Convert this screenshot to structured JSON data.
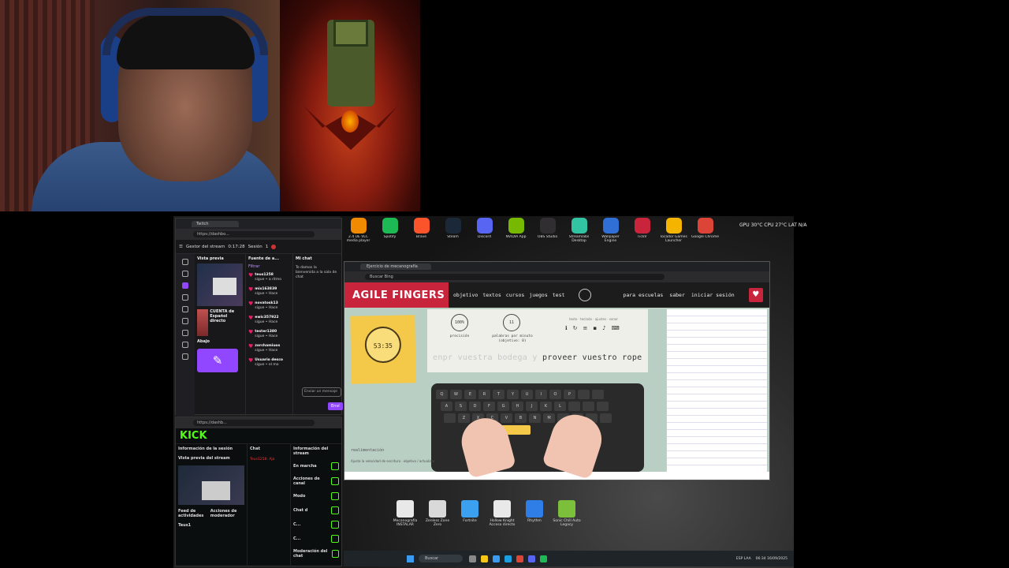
{
  "desktop_icons": [
    {
      "label": "2.4 UE VLC media player",
      "color": "#f08a00",
      "icon": "vlc-icon"
    },
    {
      "label": "Spotify",
      "color": "#1db954",
      "icon": "spotify-icon"
    },
    {
      "label": "Brave",
      "color": "#fb542b",
      "icon": "brave-icon"
    },
    {
      "label": "Steam",
      "color": "#1b2838",
      "icon": "steam-icon"
    },
    {
      "label": "Discord",
      "color": "#5865f2",
      "icon": "discord-icon"
    },
    {
      "label": "NVIDIA App",
      "color": "#76b900",
      "icon": "nvidia-icon"
    },
    {
      "label": "OBS Studio",
      "color": "#302e31",
      "icon": "obs-icon"
    },
    {
      "label": "Streamlabs Desktop",
      "color": "#31c3a2",
      "icon": "streamlabs-icon"
    },
    {
      "label": "Wallpaper Engine",
      "color": "#2f6fd6",
      "icon": "wallpaper-engine-icon"
    },
    {
      "label": "TickV",
      "color": "#c8243c",
      "icon": "tickv-icon"
    },
    {
      "label": "Tocador Games Launcher",
      "color": "#f4b400",
      "icon": "launcher-icon"
    },
    {
      "label": "Google Chrome",
      "color": "#db4437",
      "icon": "chrome-icon"
    }
  ],
  "system_stats": "GPU 30°C  CPU 27°C  LAT N/A",
  "twitch": {
    "tab_title": "Twitch",
    "url": "https://dashbo...",
    "manager_label": "Gestor del stream",
    "timer": "0:17:28",
    "timer_sub": "Sesión",
    "viewers": "1",
    "preview_header": "Vista previa",
    "activity_header": "Fuente de a...",
    "chat_header": "Mi chat",
    "filter": "Filtrar",
    "followers": [
      {
        "name": "teus1258",
        "action": "sigue • a ritmo"
      },
      {
        "name": "mix163839",
        "action": "sigue • Hace"
      },
      {
        "name": "novatosk13",
        "action": "sigue • Hace"
      },
      {
        "name": "ewic357922",
        "action": "sigue • Hace"
      },
      {
        "name": "tester1380",
        "action": "sigue • Hace"
      },
      {
        "name": "zorchamiuos",
        "action": "sigue • Hace"
      },
      {
        "name": "Usuario desco",
        "action": "sigue • el mo"
      }
    ],
    "welcome": "Te damos la bienvenida a la sala de chat",
    "card_title": "CUENTA de Español directo",
    "below_label": "Abajo",
    "chat_placeholder": "Enviar un mensaje",
    "send_label": "Enví"
  },
  "kick": {
    "logo": "KICK",
    "url": "https://dashb...",
    "info_label": "Información de la sesión",
    "preview_label": "Vista previa del stream",
    "feed_label": "Feed de actividades",
    "mod_actions_label": "Acciones de moderador",
    "feed_user": "Teus1",
    "chat_label": "Chat",
    "chat_msg": "Teus1258: Aja",
    "stream_info_label": "Información del stream",
    "rows": [
      "En marcha",
      "Acciones de canal",
      "Modo",
      "Chat d",
      "C...",
      "C...",
      "Moderación del chat"
    ]
  },
  "agile": {
    "tab_title": "Ejercicio de mecanografía",
    "url": "Buscar Bing",
    "logo": "AGILE FINGERS",
    "menu": [
      "objetivo",
      "textos",
      "cursos",
      "juegos",
      "test"
    ],
    "right_menu": [
      "para escuelas",
      "saber",
      "iniciar sesión"
    ],
    "timer": "53:35",
    "precision_value": "100%",
    "precision_label": "precisión",
    "wpm_value": "11",
    "wpm_label": "palabras por minuto (objetivo: 0)",
    "toolbar_text": "texto · teclado · ajustes · sonar",
    "typed": "enpr vuestra bodega y",
    "remaining": " proveer vuestro rope",
    "realtime_label": "realimentación",
    "caption": "Ajusta la velocidad de escritura · objetivo / actualizar",
    "keyboard_rows": [
      [
        "Q",
        "W",
        "E",
        "R",
        "T",
        "Y",
        "U",
        "I",
        "O",
        "P",
        "",
        ""
      ],
      [
        "A",
        "S",
        "D",
        "F",
        "G",
        "H",
        "J",
        "K",
        "L",
        "",
        "",
        ""
      ],
      [
        "",
        "Z",
        "X",
        "C",
        "V",
        "B",
        "N",
        "M",
        "",
        "",
        "",
        ""
      ]
    ]
  },
  "bottom_icons": [
    {
      "label": "Mecanografía INSTALAR",
      "color": "#e8e8e8",
      "icon": "document-icon"
    },
    {
      "label": "Zenless Zone Zero",
      "color": "#d9d9d9",
      "icon": "zzz-icon"
    },
    {
      "label": "Fortnite",
      "color": "#3ba0f0",
      "icon": "fortnite-icon"
    },
    {
      "label": "Hollow Knight Acceso directo",
      "color": "#e9e9e9",
      "icon": "hollow-knight-icon"
    },
    {
      "label": "Rhythm",
      "color": "#2f7ee8",
      "icon": "rhythm-icon"
    },
    {
      "label": "Sonic Chill Auto Legacy",
      "color": "#7cbf3a",
      "icon": "game-icon"
    }
  ],
  "taskbar": {
    "search": "Buscar",
    "lang": "ESP LAA",
    "time": "06:34",
    "date": "16/09/2025"
  }
}
